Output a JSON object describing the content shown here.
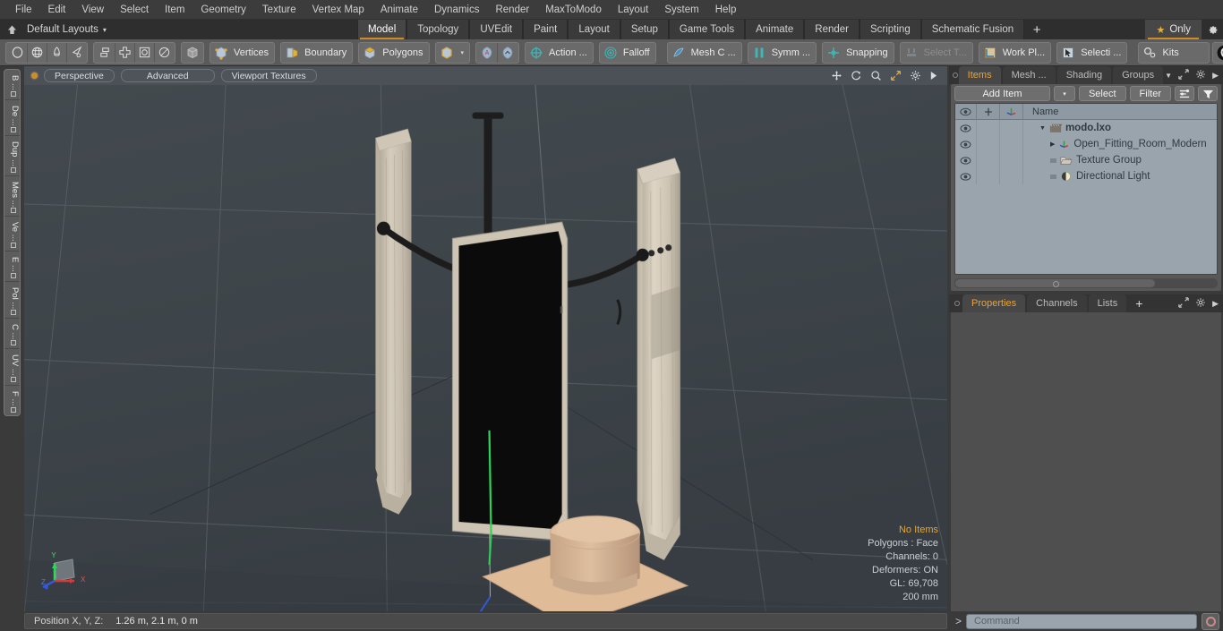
{
  "menubar": {
    "items": [
      "File",
      "Edit",
      "View",
      "Select",
      "Item",
      "Geometry",
      "Texture",
      "Vertex Map",
      "Animate",
      "Dynamics",
      "Render",
      "MaxToModo",
      "Layout",
      "System",
      "Help"
    ]
  },
  "layout_row": {
    "home_icon": "home-icon",
    "layout_selector": "Default Layouts",
    "caret": "▾",
    "tabs": [
      {
        "label": "Model",
        "active": true
      },
      {
        "label": "Topology",
        "active": false
      },
      {
        "label": "UVEdit",
        "active": false
      },
      {
        "label": "Paint",
        "active": false
      },
      {
        "label": "Layout",
        "active": false
      },
      {
        "label": "Setup",
        "active": false
      },
      {
        "label": "Game Tools",
        "active": false
      },
      {
        "label": "Animate",
        "active": false
      },
      {
        "label": "Render",
        "active": false
      },
      {
        "label": "Scripting",
        "active": false
      },
      {
        "label": "Schematic Fusion",
        "active": false
      }
    ],
    "add_tab": "+",
    "only_button": "Only",
    "star_icon": "star-icon",
    "gear_icon": "gear-icon"
  },
  "toolbar": {
    "group_primitives": [
      {
        "icon": "sphere-icon"
      },
      {
        "icon": "globe-icon"
      },
      {
        "icon": "cone-icon"
      },
      {
        "icon": "teardrop-icon"
      }
    ],
    "group_secondary": [
      {
        "icon": "stack-icon"
      },
      {
        "icon": "cross-icon"
      },
      {
        "icon": "square-in-square-icon"
      },
      {
        "icon": "circle-outline-icon"
      }
    ],
    "cube_icon": "cube-icon",
    "selection_modes": [
      {
        "label": "Vertices",
        "icon": "vertices-icon"
      },
      {
        "label": "Boundary",
        "icon": "boundary-icon"
      },
      {
        "label": "Polygons",
        "icon": "polygons-icon"
      }
    ],
    "items_mode": {
      "icon": "items-cube-icon",
      "caret": "▾"
    },
    "mode_icons": [
      {
        "icon": "select-through-a-icon"
      },
      {
        "icon": "select-through-b-icon"
      }
    ],
    "action_center": {
      "label": "Action  ...",
      "icon": "action-center-icon"
    },
    "falloff": {
      "label": "Falloff",
      "icon": "falloff-icon"
    },
    "mesh_constraint": {
      "label": "Mesh C ...",
      "icon": "mesh-constraint-icon"
    },
    "symmetry": {
      "label": "Symm ...",
      "icon": "symmetry-icon"
    },
    "snapping": {
      "label": "Snapping",
      "icon": "snapping-icon"
    },
    "select_through": {
      "label": "Select T...",
      "icon": "select-through-icon",
      "disabled": true
    },
    "work_plane": {
      "label": "Work Pl...",
      "icon": "work-plane-icon"
    },
    "selection_set": {
      "label": "Selecti ...",
      "icon": "selection-icon"
    },
    "kits": {
      "label": "Kits",
      "icon": "kits-icon"
    },
    "app_icons": [
      {
        "icon": "modo-icon"
      },
      {
        "icon": "unreal-icon"
      }
    ]
  },
  "left_toolbar": {
    "tabs": [
      "B ...",
      "De ...",
      "Dup ...",
      "Mes ...",
      "Ve ...",
      "E ...",
      "Pol ...",
      "C ...",
      "UV ...",
      "F ..."
    ]
  },
  "viewport": {
    "header": {
      "indicator": "active-dot",
      "buttons": [
        "Perspective",
        "Advanced",
        "Viewport Textures"
      ],
      "icons": [
        "move-icon",
        "rotate-icon",
        "zoom-icon",
        "fit-icon",
        "gear-icon",
        "play-icon"
      ]
    },
    "stats": {
      "selection": "No Items",
      "polygons": "Polygons : Face",
      "channels": "Channels: 0",
      "deformers": "Deformers: ON",
      "gl": "GL: 69,708",
      "scale": "200 mm"
    },
    "axis_gizmo": {
      "x": "X",
      "y": "Y",
      "z": "Z"
    }
  },
  "right_panel": {
    "tabs": [
      {
        "label": "Items",
        "active": true
      },
      {
        "label": "Mesh ...",
        "active": false
      },
      {
        "label": "Shading",
        "active": false
      },
      {
        "label": "Groups",
        "active": false
      }
    ],
    "tab_icons": [
      "chevron-down-icon",
      "expand-icon",
      "gear-icon",
      "play-icon"
    ],
    "toolbar": {
      "add_item": "Add Item",
      "add_item_caret": "▾",
      "select": "Select",
      "filter": "Filter",
      "list_icon": "list-view-icon",
      "funnel_icon": "funnel-icon"
    },
    "table": {
      "columns": [
        "eye-icon",
        "lock-icon",
        "axis-icon",
        "Name"
      ],
      "rows": [
        {
          "name": "modo.lxo",
          "icon": "scene-icon",
          "depth": 0,
          "expanded": true,
          "bold": true,
          "eye": true
        },
        {
          "name": "Open_Fitting_Room_Modern",
          "icon": "mesh-axis-icon",
          "depth": 1,
          "expanded": false,
          "bold": false,
          "eye": true
        },
        {
          "name": "Texture Group",
          "icon": "folder-icon",
          "depth": 1,
          "expanded": null,
          "bold": false,
          "eye": true
        },
        {
          "name": "Directional Light",
          "icon": "light-icon",
          "depth": 1,
          "expanded": null,
          "bold": false,
          "eye": true
        }
      ]
    }
  },
  "bottom_panel": {
    "tabs": [
      {
        "label": "Properties",
        "active": true
      },
      {
        "label": "Channels",
        "active": false
      },
      {
        "label": "Lists",
        "active": false
      },
      {
        "label": "+",
        "active": false
      }
    ],
    "icons": [
      "expand-icon",
      "gear-icon",
      "play-icon"
    ]
  },
  "statusbar": {
    "position_label": "Position X, Y, Z:",
    "position_value": "1.26 m, 2.1 m, 0 m",
    "command_chevron": ">",
    "command_placeholder": "Command",
    "record_icon": "record-icon"
  },
  "colors": {
    "accent": "#d08a24",
    "highlight_text": "#e0a73c",
    "toolbar_bg": "#5a5a5a",
    "viewport_bg": "#3f464a",
    "panel_list_bg": "#9aa4ad"
  }
}
